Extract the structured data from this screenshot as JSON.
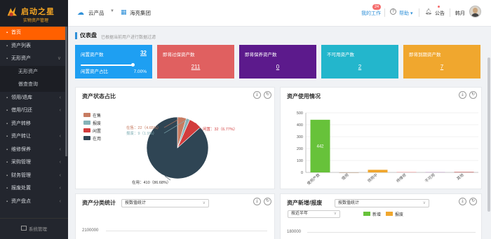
{
  "app": {
    "logo_text": "启动之星",
    "logo_sub": "实物资产管理",
    "footer_label": "系统管理"
  },
  "sidebar": {
    "items": [
      {
        "label": "首页",
        "icon": "home-icon",
        "active": true,
        "arrow": ""
      },
      {
        "label": "资产列表",
        "icon": "list-icon",
        "arrow": ""
      },
      {
        "label": "无形资产",
        "icon": "cube-icon",
        "arrow": "∨"
      },
      {
        "label": "无形资产",
        "sub": true,
        "arrow": ""
      },
      {
        "label": "傲查查询",
        "sub": true,
        "arrow": ""
      },
      {
        "label": "领用/退库",
        "icon": "swap-icon",
        "arrow": "‹"
      },
      {
        "label": "借用/归还",
        "icon": "borrow-icon",
        "arrow": "‹"
      },
      {
        "label": "资产转移",
        "icon": "transfer-icon",
        "arrow": ""
      },
      {
        "label": "资产转让",
        "icon": "transfer-icon",
        "arrow": "‹"
      },
      {
        "label": "维修保养",
        "icon": "wrench-icon",
        "arrow": "‹"
      },
      {
        "label": "采购管理",
        "icon": "cart-icon",
        "arrow": "‹"
      },
      {
        "label": "财务管理",
        "icon": "finance-icon",
        "arrow": "‹"
      },
      {
        "label": "报废处置",
        "icon": "trash-icon",
        "arrow": "‹"
      },
      {
        "label": "资产盘点",
        "icon": "check-icon",
        "arrow": "‹"
      }
    ]
  },
  "header": {
    "product": "云产品",
    "group": "海亮集团",
    "work_label": "我的工作",
    "work_badge": "24",
    "help": "帮助",
    "notice": "公告",
    "user": "韩月"
  },
  "panel": {
    "title": "仪表盘",
    "subtitle": "已根据当前用户进行数据过滤"
  },
  "kpis": [
    {
      "title": "闲置资产数",
      "value": "32",
      "progress": 0.93,
      "sub_label": "闲置资产占比",
      "sub_value": "7.00%",
      "color": "#1e9ff2"
    },
    {
      "title": "即将过保资产数",
      "value": "211",
      "color": "#e06060"
    },
    {
      "title": "即将保养资产数",
      "value": "0",
      "color": "#5c1a8c"
    },
    {
      "title": "不可用资产数",
      "value": "2",
      "color": "#23b6cc"
    },
    {
      "title": "即将到期资产数",
      "value": "7",
      "color": "#f0a72e"
    }
  ],
  "cards": {
    "status": {
      "title": "资产状态占比",
      "download_icon": "download-icon",
      "refresh_icon": "refresh-icon"
    },
    "usage": {
      "title": "资产使用情况"
    },
    "category": {
      "title": "资产分类统计",
      "select": "按数值统计"
    },
    "added": {
      "title": "资产新增/报废",
      "select": "按数值统计",
      "select2": "按近半年",
      "legend": [
        "新增",
        "报废"
      ],
      "legend_colors": [
        "#67c23a",
        "#f0a72e"
      ]
    }
  },
  "chart_data": [
    {
      "type": "pie",
      "legend": [
        "在售",
        "报废",
        "闲置",
        "在用"
      ],
      "legend_colors": [
        "#c77c62",
        "#85b2b8",
        "#d23c3c",
        "#2f4554"
      ],
      "values": [
        22,
        9,
        32,
        410
      ],
      "labels": [
        "在售：22（4.65%）",
        "报废：9（1.9%）",
        "闲置：32（6.77%）",
        "在用：410（86.68%）"
      ]
    },
    {
      "type": "bar",
      "categories": [
        "使用产数",
        "借用",
        "领用中",
        "待维修",
        "不可用",
        "其他"
      ],
      "values": [
        442,
        0,
        22,
        3,
        2,
        4
      ],
      "bar_labels": [
        "442",
        "",
        "",
        "",
        "",
        ""
      ],
      "colors": [
        "#67c23a",
        "#9b6a3c",
        "#f0a72e",
        "#f08080",
        "#b080c0",
        "#c0504d"
      ],
      "y_ticks": [
        "500",
        "400",
        "300",
        "200",
        "100",
        "0"
      ],
      "ylim": [
        0,
        500
      ]
    },
    {
      "type": "bar",
      "y_ticks": [
        "2100000"
      ]
    },
    {
      "type": "bar",
      "y_ticks": [
        "180000"
      ]
    }
  ]
}
